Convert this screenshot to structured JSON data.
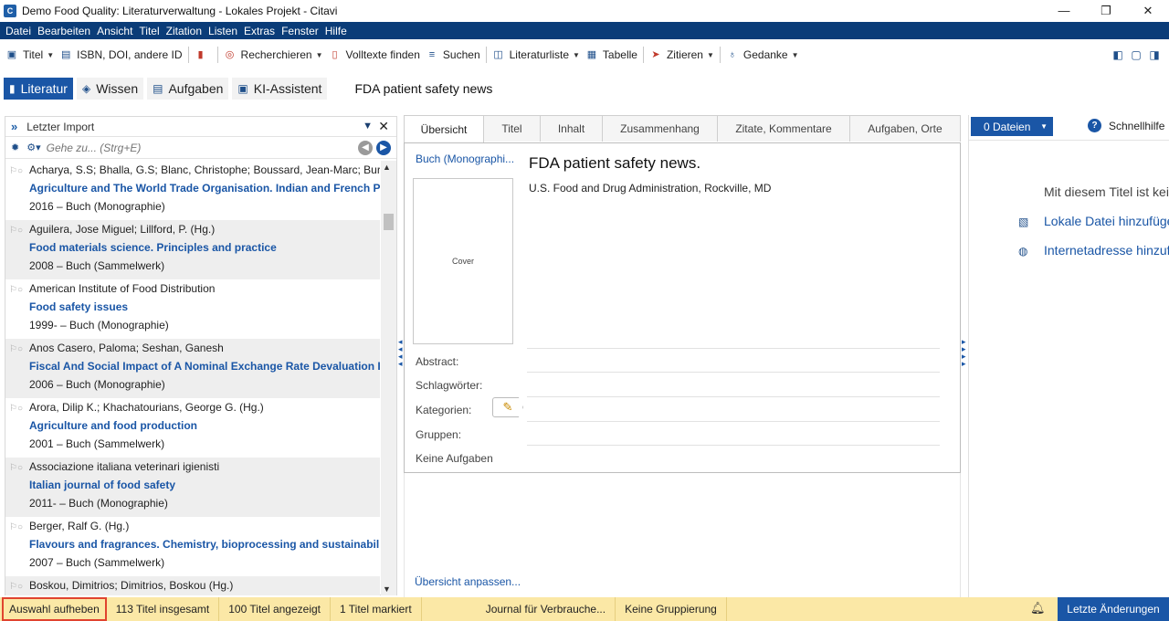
{
  "window": {
    "title": "Demo Food Quality: Literaturverwaltung - Lokales Projekt - Citavi",
    "controls": [
      "—",
      "❐",
      "✕"
    ]
  },
  "menu": [
    "Datei",
    "Bearbeiten",
    "Ansicht",
    "Titel",
    "Zitation",
    "Listen",
    "Extras",
    "Fenster",
    "Hilfe"
  ],
  "toolbar": {
    "titel": "Titel",
    "isbn": "ISBN, DOI, andere ID",
    "recherchieren": "Recherchieren",
    "volltexte": "Volltexte finden",
    "suchen": "Suchen",
    "literaturliste": "Literaturliste",
    "tabelle": "Tabelle",
    "zitieren": "Zitieren",
    "gedanke": "Gedanke"
  },
  "nav": {
    "literatur": "Literatur",
    "wissen": "Wissen",
    "aufgaben": "Aufgaben",
    "ki": "KI-Assistent",
    "record_title": "FDA patient safety news"
  },
  "left_panel": {
    "header": "Letzter Import",
    "search_placeholder": "Gehe zu... (Strg+E)",
    "items": [
      {
        "authors": "Acharya, S.S; Bhalla, G.S; Blanc, Christophe; Boussard, Jean-Marc; Bure",
        "title": "Agriculture and The World Trade Organisation. Indian and French P",
        "meta": "2016 – Buch (Monographie)"
      },
      {
        "authors": "Aguilera, Jose Miguel; Lillford, P. (Hg.)",
        "title": "Food materials science. Principles and practice",
        "meta": "2008 – Buch (Sammelwerk)"
      },
      {
        "authors": "American Institute of Food Distribution",
        "title": "Food safety issues",
        "meta": "1999- – Buch (Monographie)"
      },
      {
        "authors": "Anos Casero, Paloma; Seshan, Ganesh",
        "title": "Fiscal And Social Impact of A Nominal Exchange Rate Devaluation I",
        "meta": "2006 – Buch (Monographie)"
      },
      {
        "authors": "Arora, Dilip K.; Khachatourians, George G. (Hg.)",
        "title": "Agriculture and food production",
        "meta": "2001 – Buch (Sammelwerk)"
      },
      {
        "authors": "Associazione italiana veterinari igienisti",
        "title": "Italian journal of food safety",
        "meta": "2011- – Buch (Monographie)"
      },
      {
        "authors": "Berger, Ralf G. (Hg.)",
        "title": "Flavours and fragrances. Chemistry, bioprocessing and sustainabilit",
        "meta": "2007 – Buch (Sammelwerk)"
      },
      {
        "authors": "Boskou, Dimitrios; Dimitrios, Boskou (Hg.)",
        "title": "",
        "meta": ""
      }
    ]
  },
  "detail_tabs": [
    "Übersicht",
    "Titel",
    "Inhalt",
    "Zusammenhang",
    "Zitate, Kommentare",
    "Aufgaben, Orte"
  ],
  "detail": {
    "doc_type": "Buch (Monographi...",
    "cover": "Cover",
    "title": "FDA patient safety news.",
    "publisher": "U.S. Food and Drug Administration, Rockville, MD",
    "abstract_label": "Abstract:",
    "keywords_label": "Schlagwörter:",
    "categories_label": "Kategorien:",
    "groups_label": "Gruppen:",
    "tasks_label": "Keine Aufgaben",
    "customize_link": "Übersicht anpassen..."
  },
  "right_panel": {
    "files_button": "0 Dateien",
    "help": "Schnellhilfe",
    "no_file_text": "Mit diesem Titel ist kei",
    "local_file_link": "Lokale Datei hinzufüge",
    "web_link": "Internetadresse hinzuf"
  },
  "statusbar": {
    "clear_selection": "Auswahl aufheben",
    "total": "113 Titel insgesamt",
    "shown": "100 Titel angezeigt",
    "marked": "1 Titel markiert",
    "journal": "Journal für Verbrauche...",
    "grouping": "Keine Gruppierung",
    "last_changes": "Letzte Änderungen"
  },
  "colors": {
    "menubar": "#0a3c78",
    "accent": "#1a56a6",
    "statusbar": "#fbe8a6",
    "highlight_border": "#e0432f"
  }
}
